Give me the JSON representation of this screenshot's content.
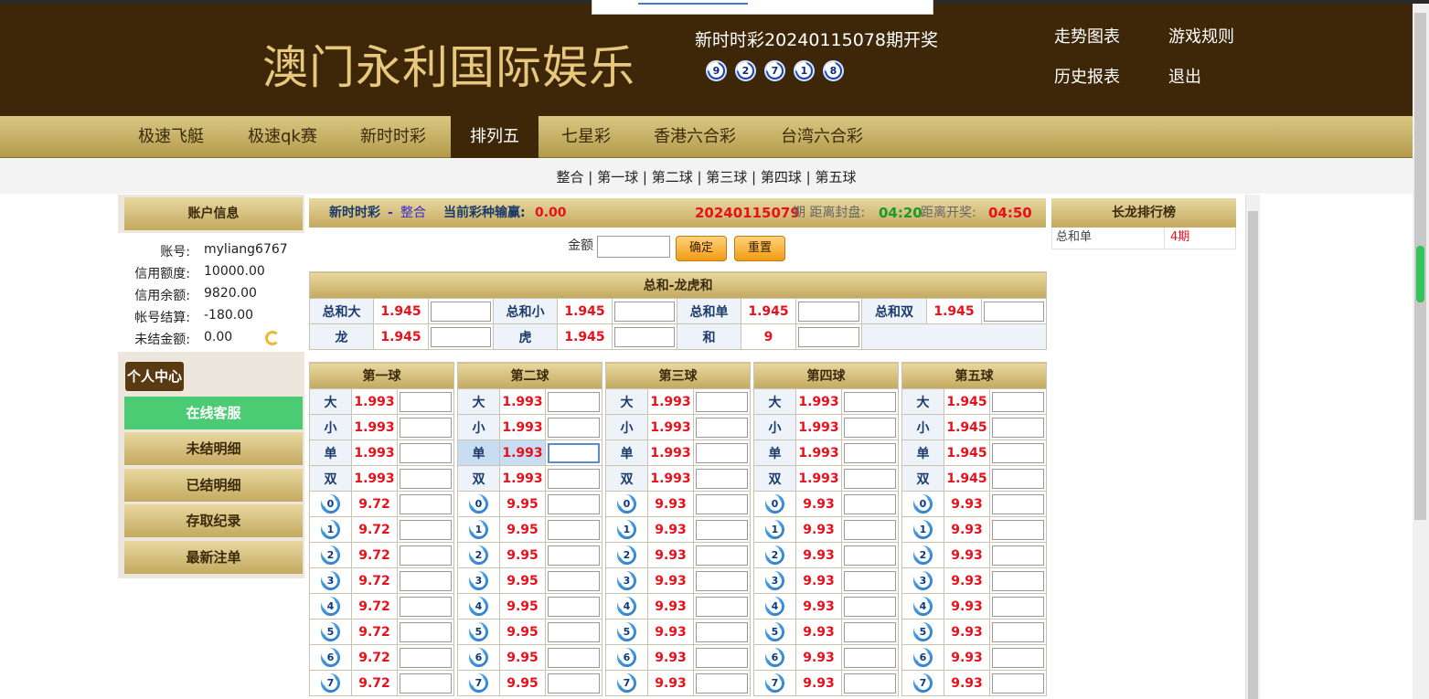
{
  "site": {
    "logo": "澳门永利国际娱乐",
    "draw_title": "新时时彩20240115078期开奖",
    "draw_numbers": [
      "9",
      "2",
      "7",
      "1",
      "8"
    ],
    "links": [
      "走势图表",
      "游戏规则",
      "历史报表",
      "退出"
    ]
  },
  "nav": {
    "items": [
      "极速飞艇",
      "极速qk赛",
      "新时时彩",
      "排列五",
      "七星彩",
      "香港六合彩",
      "台湾六合彩"
    ],
    "active": "排列五"
  },
  "subnav": {
    "text": "整合 | 第一球 | 第二球 | 第三球 | 第四球 | 第五球"
  },
  "account": {
    "title": "账户信息",
    "rows": [
      {
        "label": "账号:",
        "value": "myliang6767"
      },
      {
        "label": "信用额度:",
        "value": "10000.00"
      },
      {
        "label": "信用余额:",
        "value": "9820.00"
      },
      {
        "label": "帐号结算:",
        "value": "-180.00"
      },
      {
        "label": "未结金额:",
        "value": "0.00"
      }
    ]
  },
  "personal": {
    "title": "个人中心",
    "items": [
      "在线客服",
      "未结明细",
      "已结明细",
      "存取纪录",
      "最新注单"
    ]
  },
  "header_bar": {
    "game": "新时时彩",
    "sep": "-",
    "mode": "整合",
    "profit_label": "当前彩种输赢:",
    "profit": "0.00",
    "period": "20240115079",
    "period_suffix": "期 距离封盘:",
    "close_time": "04:20",
    "open_label": "距离开奖:",
    "open_time": "04:50"
  },
  "form": {
    "amount_label": "金额",
    "confirm": "确定",
    "reset": "重置"
  },
  "sum_table": {
    "title": "总和-龙虎和",
    "row1": [
      {
        "label": "总和大",
        "odds": "1.945"
      },
      {
        "label": "总和小",
        "odds": "1.945"
      },
      {
        "label": "总和单",
        "odds": "1.945"
      },
      {
        "label": "总和双",
        "odds": "1.945"
      }
    ],
    "row2": [
      {
        "label": "龙",
        "odds": "1.945"
      },
      {
        "label": "虎",
        "odds": "1.945"
      },
      {
        "label": "和",
        "odds": "9"
      }
    ]
  },
  "balls": [
    {
      "title": "第一球",
      "bsoe": [
        {
          "label": "大",
          "odds": "1.993"
        },
        {
          "label": "小",
          "odds": "1.993"
        },
        {
          "label": "单",
          "odds": "1.993"
        },
        {
          "label": "双",
          "odds": "1.993"
        }
      ],
      "num_odds": "9.72"
    },
    {
      "title": "第二球",
      "bsoe": [
        {
          "label": "大",
          "odds": "1.993"
        },
        {
          "label": "小",
          "odds": "1.993"
        },
        {
          "label": "单",
          "odds": "1.993"
        },
        {
          "label": "双",
          "odds": "1.993"
        }
      ],
      "num_odds": "9.95"
    },
    {
      "title": "第三球",
      "bsoe": [
        {
          "label": "大",
          "odds": "1.993"
        },
        {
          "label": "小",
          "odds": "1.993"
        },
        {
          "label": "单",
          "odds": "1.993"
        },
        {
          "label": "双",
          "odds": "1.993"
        }
      ],
      "num_odds": "9.93"
    },
    {
      "title": "第四球",
      "bsoe": [
        {
          "label": "大",
          "odds": "1.993"
        },
        {
          "label": "小",
          "odds": "1.993"
        },
        {
          "label": "单",
          "odds": "1.993"
        },
        {
          "label": "双",
          "odds": "1.993"
        }
      ],
      "num_odds": "9.93"
    },
    {
      "title": "第五球",
      "bsoe": [
        {
          "label": "大",
          "odds": "1.945"
        },
        {
          "label": "小",
          "odds": "1.945"
        },
        {
          "label": "单",
          "odds": "1.945"
        },
        {
          "label": "双",
          "odds": "1.945"
        }
      ],
      "num_odds": "9.93"
    }
  ],
  "numbers": [
    "0",
    "1",
    "2",
    "3",
    "4",
    "5",
    "6",
    "7"
  ],
  "dragon": {
    "title": "长龙排行榜",
    "rows": [
      {
        "name": "总和单",
        "value": "4期"
      }
    ]
  }
}
